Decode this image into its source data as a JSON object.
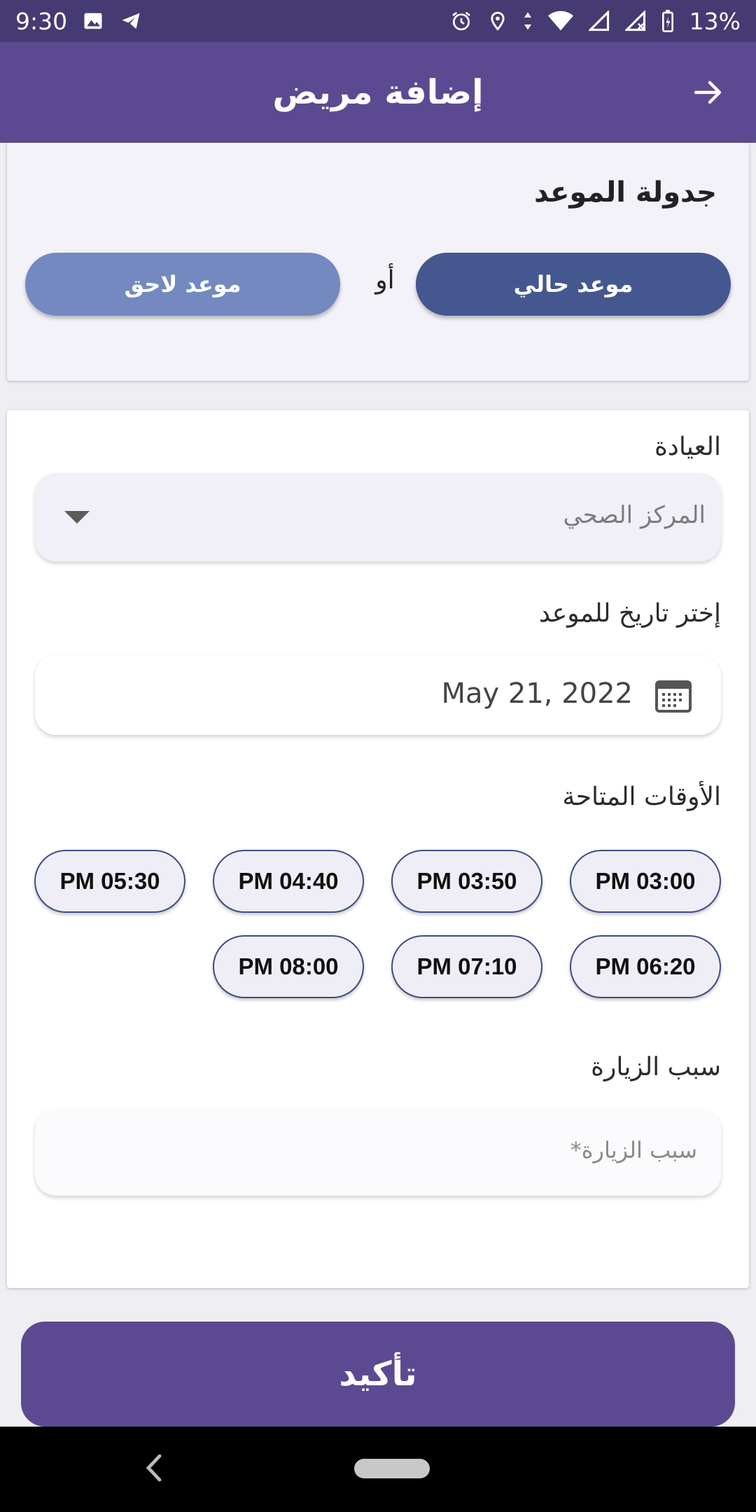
{
  "status_bar": {
    "time": "9:30",
    "battery": "13%"
  },
  "app_bar": {
    "title": "إضافة مريض",
    "back_icon": "arrow-right-icon"
  },
  "schedule": {
    "title": "جدولة الموعد",
    "current_label": "موعد حالي",
    "or_label": "أو",
    "later_label": "موعد لاحق"
  },
  "clinic": {
    "label": "العيادة",
    "selected": "المركز الصحي"
  },
  "date": {
    "label": "إختر تاريخ للموعد",
    "value": "May 21, 2022"
  },
  "times": {
    "label": "الأوقات المتاحة",
    "slots": [
      "PM 03:00",
      "PM 03:50",
      "PM 04:40",
      "PM 05:30",
      "PM 06:20",
      "PM 07:10",
      "PM 08:00"
    ]
  },
  "reason": {
    "label": "سبب الزيارة",
    "placeholder": "سبب الزيارة*"
  },
  "confirm_label": "تأكيد",
  "colors": {
    "primary": "#5b4a91",
    "status_bar": "#463a72",
    "current_button": "#44578f",
    "later_button": "#7389bf",
    "chip_border": "#3f4d86"
  }
}
